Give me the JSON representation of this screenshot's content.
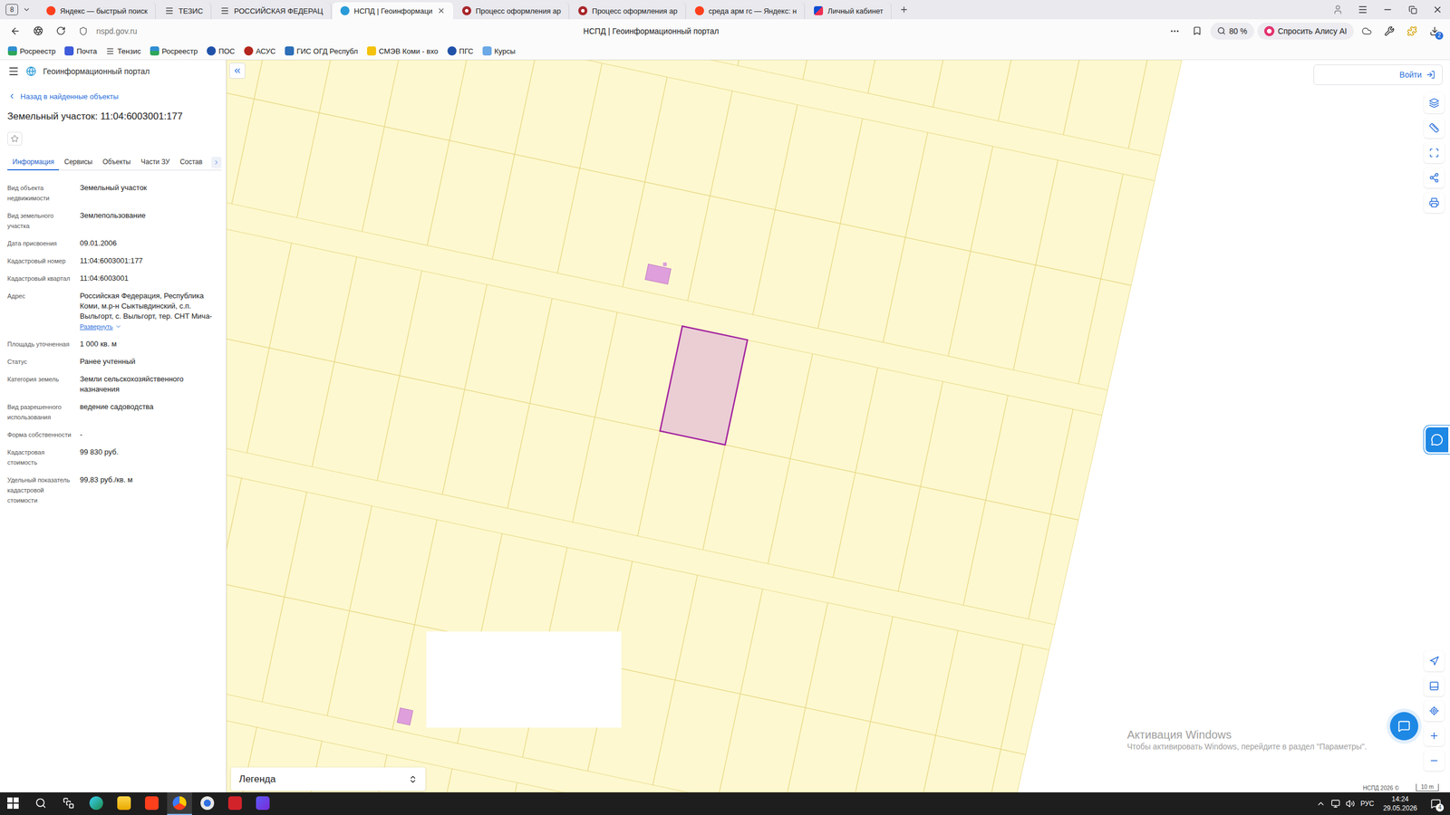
{
  "browser": {
    "tab_counter": "8",
    "tabs": [
      {
        "label": "Яндекс — быстрый поиск",
        "kind": "yandex",
        "selected": false
      },
      {
        "label": "ТЕЗИС",
        "kind": "menu",
        "selected": false
      },
      {
        "label": "РОССИЙСКАЯ ФЕДЕРАЦ",
        "kind": "menu",
        "selected": false
      },
      {
        "label": "НСПД | Геоинформаци",
        "kind": "nspd",
        "selected": true
      },
      {
        "label": "Процесс оформления ар",
        "kind": "process",
        "selected": false
      },
      {
        "label": "Процесс оформления ар",
        "kind": "process",
        "selected": false
      },
      {
        "label": "среда арм гс — Яндекс: н",
        "kind": "yandex",
        "selected": false
      },
      {
        "label": "Личный кабинет",
        "kind": "gosuslugi",
        "selected": false
      }
    ],
    "address": "nspd.gov.ru",
    "page_title": "НСПД | Геоинформационный портал",
    "zoom": "80 %",
    "alice": "Спросить Алису AI",
    "downloads_badge": "2",
    "bookmarks": [
      {
        "label": "Росреестр",
        "kind": "rosreestr"
      },
      {
        "label": "Почта",
        "kind": "mail"
      },
      {
        "label": "Тензис",
        "kind": "menu"
      },
      {
        "label": "Росреестр",
        "kind": "rosreestr"
      },
      {
        "label": "ПОС",
        "kind": "pos"
      },
      {
        "label": "АСУС",
        "kind": "asus"
      },
      {
        "label": "ГИС ОГД Республ",
        "kind": "gis"
      },
      {
        "label": "СМЭВ Коми - вхо",
        "kind": "folder"
      },
      {
        "label": "ПГС",
        "kind": "pos"
      },
      {
        "label": "Курсы",
        "kind": "grid"
      }
    ]
  },
  "panel": {
    "header": "Геоинформационный портал",
    "back": "Назад в найденные объекты",
    "title": "Земельный участок: 11:04:6003001:177",
    "favorite": false,
    "tabs": [
      {
        "label": "Информация",
        "selected": true
      },
      {
        "label": "Сервисы",
        "selected": false
      },
      {
        "label": "Объекты",
        "selected": false
      },
      {
        "label": "Части ЗУ",
        "selected": false
      },
      {
        "label": "Состав",
        "selected": false
      }
    ],
    "properties": [
      {
        "label": "Вид объекта недвижимости",
        "value": "Земельный участок"
      },
      {
        "label": "Вид земельного участка",
        "value": "Землепользование"
      },
      {
        "label": "Дата присвоения",
        "value": "09.01.2006"
      },
      {
        "label": "Кадастровый номер",
        "value": "11:04:6003001:177"
      },
      {
        "label": "Кадастровый квартал",
        "value": "11:04:6003001"
      },
      {
        "label": "Адрес",
        "value": "Российская Федерация, Республика Коми, м.р-н Сыктывдинский, с.п. Выльгорт, с. Выльгорт, тер. СНТ Мича-",
        "expand": "Развернуть"
      },
      {
        "label": "Площадь уточненная",
        "value": "1 000 кв. м"
      },
      {
        "label": "Статус",
        "value": "Ранее учтенный"
      },
      {
        "label": "Категория земель",
        "value": "Земли сельскохозяйственного назначения"
      },
      {
        "label": "Вид разрешенного использования",
        "value": "ведение садоводства"
      },
      {
        "label": "Форма собственности",
        "value": "-"
      },
      {
        "label": "Кадастровая стоимость",
        "value": "99 830 руб."
      },
      {
        "label": "Удельный показатель кадастровой стоимости",
        "value": "99,83 руб./кв. м"
      }
    ]
  },
  "map": {
    "login": "Войти",
    "legend": "Легенда",
    "attribution": "НСПД 2026 ©",
    "scale": "10 m",
    "selected_parcel": {
      "highlighted": true
    }
  },
  "watermark": {
    "title": "Активация Windows",
    "text": "Чтобы активировать Windows, перейдите в раздел \"Параметры\"."
  },
  "taskbar": {
    "apps": [
      {
        "kind": "start",
        "selected": false
      },
      {
        "kind": "search",
        "selected": false
      },
      {
        "kind": "taskview",
        "selected": false
      },
      {
        "kind": "edge",
        "selected": false
      },
      {
        "kind": "explorer",
        "selected": false
      },
      {
        "kind": "yandex",
        "selected": false
      },
      {
        "kind": "yandex-browser",
        "selected": true
      },
      {
        "kind": "chromium",
        "selected": false
      },
      {
        "kind": "wps",
        "selected": false
      },
      {
        "kind": "messenger",
        "selected": false
      }
    ],
    "language": "РУС",
    "time": "14:24",
    "date": "29.05.2026",
    "notifications": "4"
  }
}
